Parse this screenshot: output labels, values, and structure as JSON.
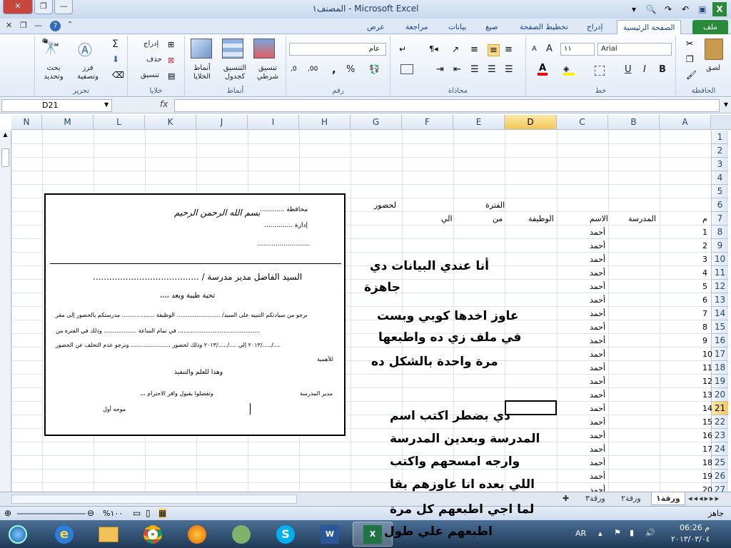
{
  "window": {
    "title": "المصنف١ - Microsoft Excel",
    "minimize": "—",
    "restore": "❐",
    "close": "✕"
  },
  "ribbon_tabs": [
    "ملف",
    "الصفحة الرئيسية",
    "إدراج",
    "تخطيط الصفحة",
    "صيغ",
    "بيانات",
    "مراجعة",
    "عرض"
  ],
  "ribbon": {
    "clipboard": {
      "group": "الحافظة",
      "paste": "لصق"
    },
    "font": {
      "group": "خط",
      "font_name": "Arial",
      "font_size": "١١",
      "bold": "B",
      "italic": "I",
      "underline": "U",
      "grow": "A",
      "shrink": "A"
    },
    "alignment": {
      "group": "محاذاة"
    },
    "number": {
      "group": "رقم",
      "format": "عام",
      "percent": "%",
      "comma": ","
    },
    "styles": {
      "group": "أنماط",
      "conditional": "تنسيق شرطي",
      "as_table": "التنسيق كجدول",
      "cell_styles": "أنماط الخلايا"
    },
    "cells": {
      "group": "خلايا",
      "insert": "إدراج",
      "delete": "حذف",
      "format": "تنسيق"
    },
    "editing": {
      "group": "تحرير",
      "sort": "فرز وتصفية",
      "find": "بحث وتحديد",
      "sum": "Σ"
    }
  },
  "formula_bar": {
    "name_box": "D21",
    "fx": "fx",
    "value": ""
  },
  "columns": [
    "A",
    "B",
    "C",
    "D",
    "E",
    "F",
    "G",
    "H",
    "I",
    "J",
    "K",
    "L",
    "M",
    "N"
  ],
  "selected_column": "D",
  "rows": [
    "1",
    "2",
    "3",
    "4",
    "5",
    "6",
    "7",
    "8",
    "9",
    "10",
    "11",
    "12",
    "13",
    "14",
    "15",
    "16",
    "17",
    "18",
    "19",
    "20",
    "21",
    "22",
    "23",
    "24",
    "25",
    "26",
    "27"
  ],
  "selected_row": "21",
  "cells": {
    "period": "الفترة",
    "attend": "لحضور",
    "hdr_num": "م",
    "hdr_school": "المدرسة",
    "hdr_name": "الاسم",
    "hdr_job": "الوظيفة",
    "hdr_from": "من",
    "hdr_to": "الي",
    "nums": [
      "1",
      "2",
      "3",
      "4",
      "5",
      "6",
      "7",
      "8",
      "9",
      "10",
      "11",
      "12",
      "13",
      "14",
      "15",
      "16",
      "17",
      "18",
      "19",
      "20"
    ],
    "name_value": "أحمد"
  },
  "form": {
    "basmala": "بسم الله الرحمن الرحيم",
    "gov": "محافظة ............",
    "admin": "إدارة ..............",
    "dots": "..........................",
    "to_principal": "السيد الفاضل مدير مدرسة / .......................................",
    "greeting": "تحية طيبة وبعد ،،،،",
    "line1": "نرجو من سيادتكم التنبيه على السيد/ ........................ الوظيفة .................. مدرستكم بالحضور إلى مقر",
    "line2": "............................................. في تمام الساعة .................. وذلك في الفترة من",
    "line3": "..../...../٢٠١٣ إلي ..../...../٢٠١٣ وذلك لحضور ...................... ونرجو عدم التخلف عن الحضور",
    "line4": "للأهمية",
    "thanks": "وهذا للعلم والتنفيذ",
    "accept": "وتفضلوا بقبول وافر الاحترام ،،،",
    "school_dir": "مدير المدرسة",
    "sig": "موجه أول"
  },
  "notes": {
    "n1": "أنا عندي البيانات دي",
    "n2": "جاهزة",
    "n3": "عاوز اخدها كوبي وبست",
    "n4": "في ملف زي ده واطبعها",
    "n5": "مرة واحدة بالشكل ده",
    "n6": "دي بضطر اكتب اسم",
    "n7": "المدرسة وبعدين المدرسة",
    "n8": "وارجه امسحهم واكتب",
    "n9": "اللي بعده انا عاوزهم بقا",
    "n10": "لما اجي اطبعهم كل مرة",
    "n11": "اطبعهم علي طول"
  },
  "sheet_tabs": [
    "ورقة١",
    "ورقة٢",
    "ورقة٣"
  ],
  "status": {
    "ready": "جاهز",
    "zoom": "%١٠٠"
  },
  "taskbar": {
    "lang": "AR",
    "time": "06:26 م",
    "date": "٢٠١٣/٠٣/٠٤"
  },
  "colors": {
    "excel_green": "#2a8a3c",
    "selected_header": "#f3c65a",
    "ribbon_bg": "#e3ebf7"
  }
}
